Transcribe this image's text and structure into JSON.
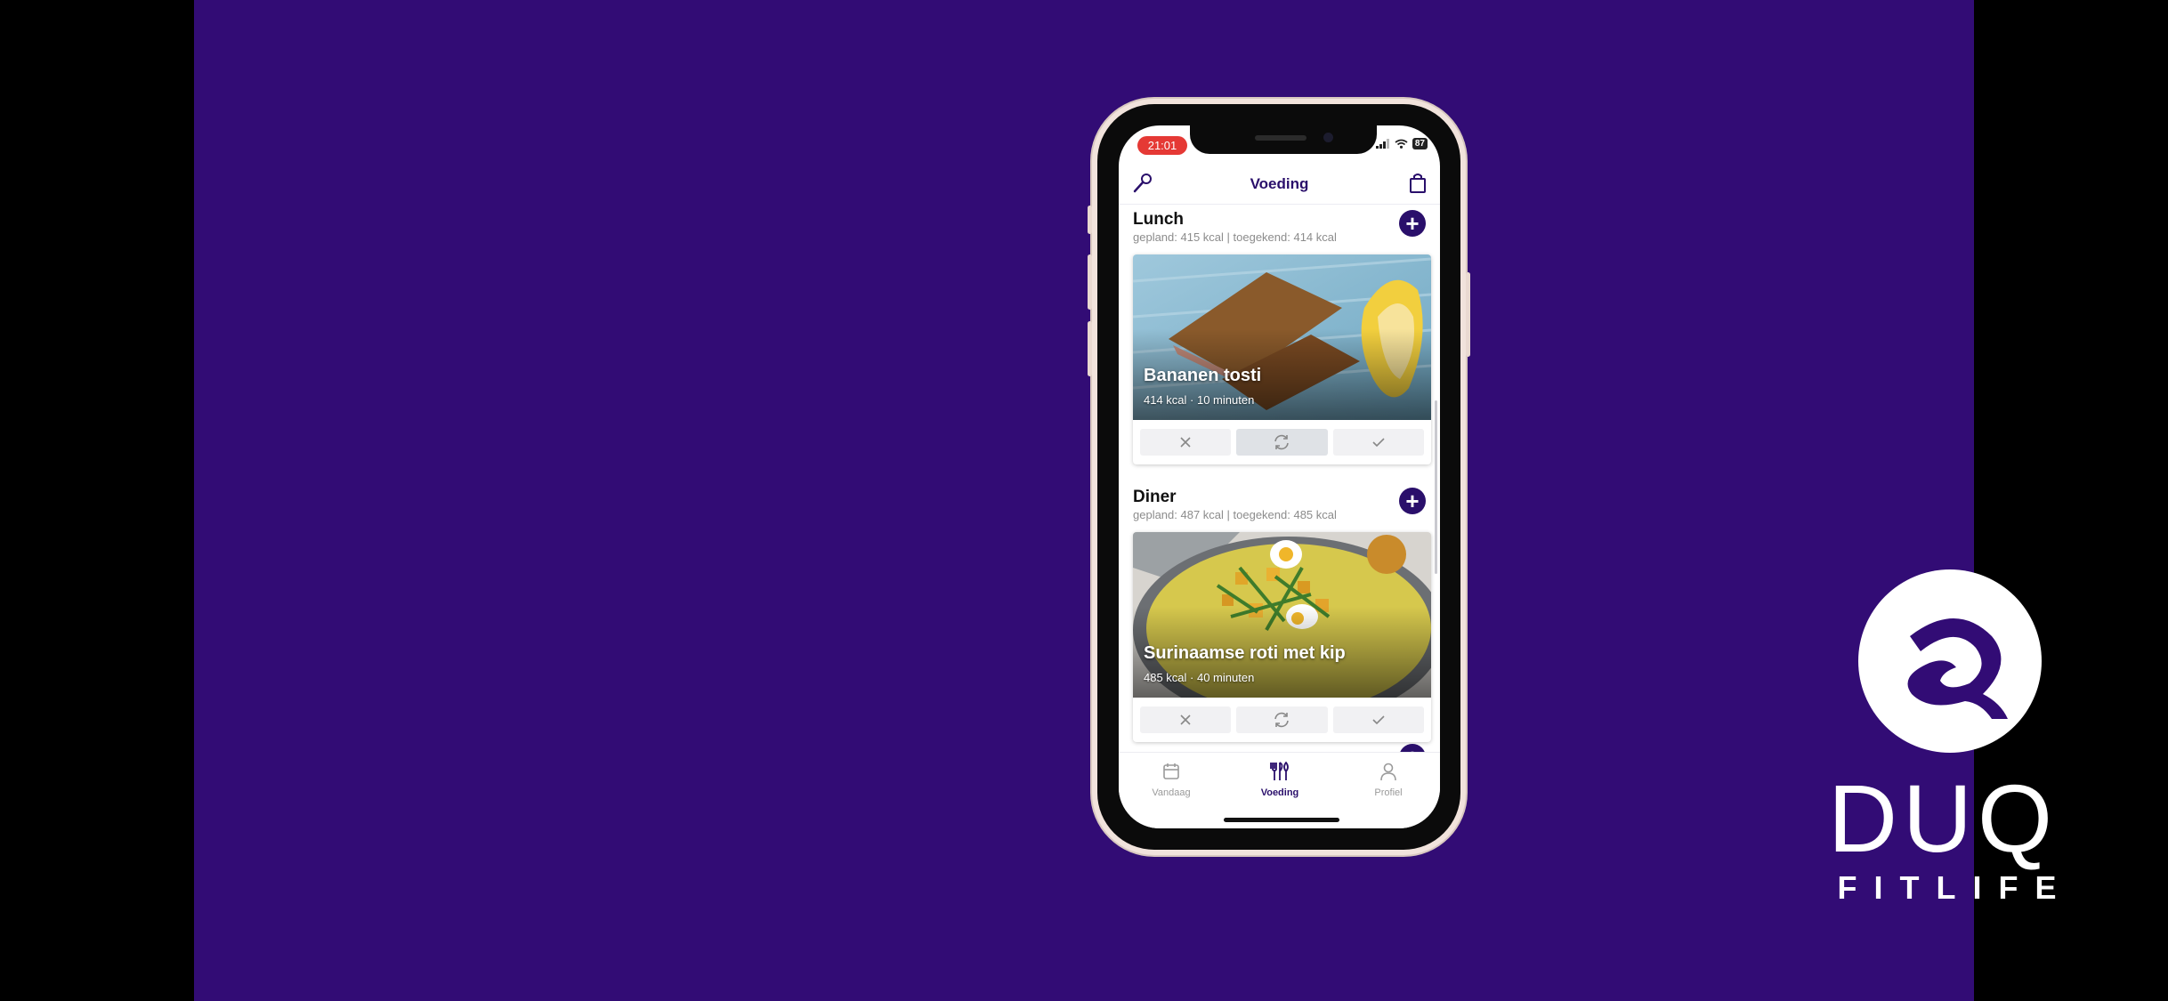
{
  "status_bar": {
    "time": "21:01",
    "battery": "87"
  },
  "header": {
    "title": "Voeding",
    "left_icon": "wrench-icon",
    "right_icon": "shopping-bag-icon"
  },
  "meals": [
    {
      "title": "Lunch",
      "subtitle": "gepland: 415 kcal | toegekend: 414 kcal",
      "recipe": {
        "name": "Bananen tosti",
        "meta": "414 kcal · 10 minuten"
      }
    },
    {
      "title": "Diner",
      "subtitle": "gepland: 487 kcal | toegekend: 485 kcal",
      "recipe": {
        "name": "Surinaamse roti met kip",
        "meta": "485 kcal · 40 minuten"
      }
    }
  ],
  "card_actions": [
    "close-icon",
    "refresh-icon",
    "check-icon"
  ],
  "tabs": [
    {
      "label": "Vandaag",
      "icon": "calendar-icon"
    },
    {
      "label": "Voeding",
      "icon": "cutlery-icon",
      "active": true
    },
    {
      "label": "Profiel",
      "icon": "user-icon"
    }
  ],
  "brand": {
    "name": "DUQ",
    "tagline": "FITLIFE"
  },
  "colors": {
    "background": "#320c75",
    "accent": "#2a0f6b",
    "status_time": "#e53935"
  }
}
